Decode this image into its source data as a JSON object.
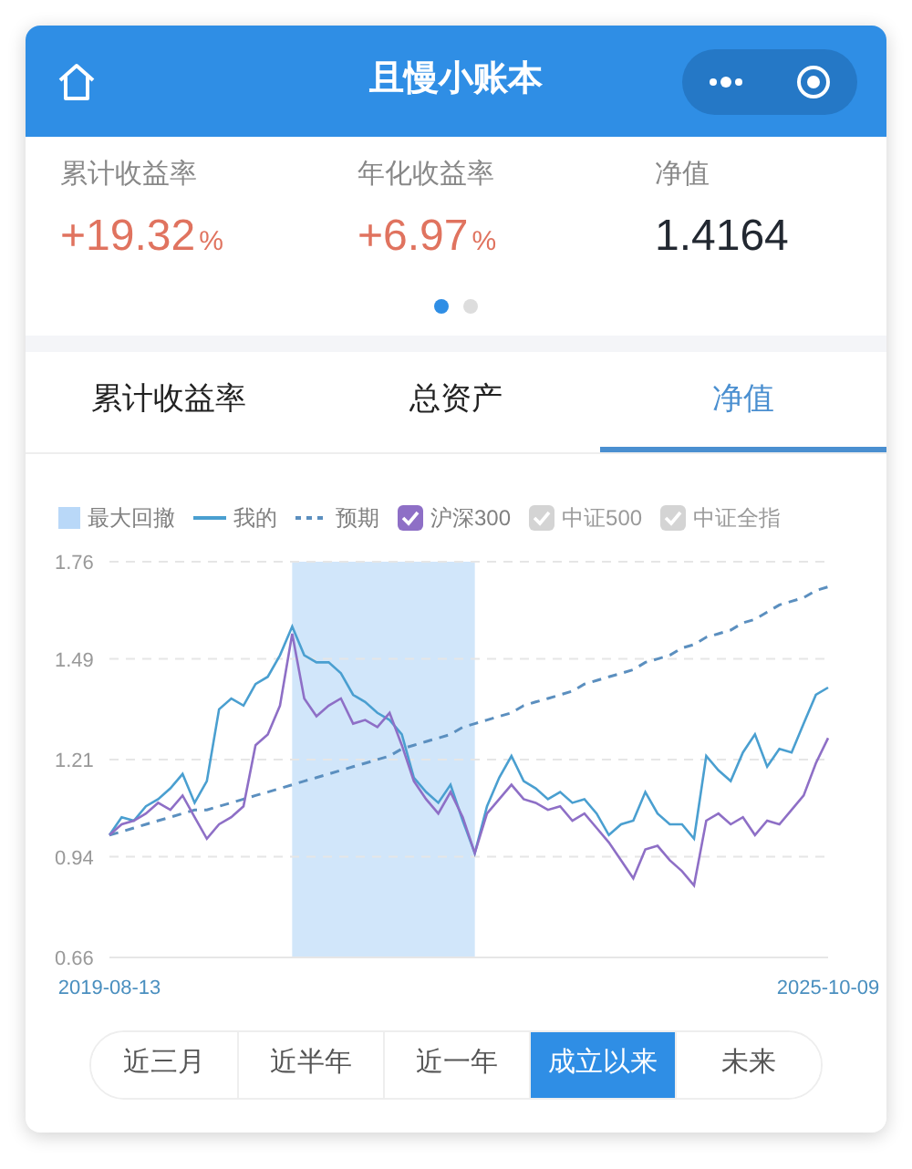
{
  "header": {
    "title": "且慢小账本"
  },
  "stats": [
    {
      "label": "累计收益率",
      "value": "+19.32",
      "unit": "%",
      "color": "#e0735f"
    },
    {
      "label": "年化收益率",
      "value": "+6.97",
      "unit": "%",
      "color": "#e0735f"
    },
    {
      "label": "净值",
      "value": "1.4164",
      "color": "#222831"
    }
  ],
  "pager": [
    {
      "selected": true
    },
    {
      "selected": false
    }
  ],
  "tabs": [
    {
      "label": "累计收益率",
      "selected": false
    },
    {
      "label": "总资产",
      "selected": false
    },
    {
      "label": "净值",
      "selected": true
    }
  ],
  "legend": [
    {
      "kind": "swatch",
      "label": "最大回撤",
      "color": "#b9d8f8"
    },
    {
      "kind": "series"
    },
    {
      "kind": "series"
    },
    {
      "kind": "series",
      "checked": true
    },
    {
      "kind": "checkbox",
      "label": "中证500",
      "checked": false
    },
    {
      "kind": "checkbox",
      "label": "中证全指",
      "checked": false
    }
  ],
  "chart_data": {
    "type": "line",
    "grid": true,
    "ylim": [
      0.66,
      1.76
    ],
    "categories": [
      "2019-08-13",
      null,
      null,
      null,
      null,
      null,
      null,
      null,
      null,
      null,
      null,
      null,
      null,
      null,
      null,
      null,
      null,
      null,
      null,
      null,
      null,
      null,
      null,
      null,
      null,
      null,
      null,
      null,
      null,
      null,
      null,
      null,
      null,
      null,
      null,
      null,
      null,
      null,
      null,
      null,
      null,
      null,
      null,
      null,
      null,
      null,
      null,
      null,
      null,
      null,
      null,
      null,
      null,
      null,
      null,
      null,
      null,
      null,
      null,
      "2025-10-09"
    ],
    "yticks": [
      {
        "value": 1.76,
        "label": "1.76"
      },
      {
        "value": 1.49,
        "label": "1.49"
      },
      {
        "value": 1.21,
        "label": "1.21"
      },
      {
        "value": 0.94,
        "label": "0.94"
      },
      {
        "value": 0.66,
        "label": "0.66"
      }
    ],
    "series": [
      {
        "name": "我的",
        "color": "#4a9fd0",
        "values": [
          1.0,
          1.05,
          1.04,
          1.08,
          1.1,
          1.13,
          1.17,
          1.09,
          1.15,
          1.35,
          1.38,
          1.36,
          1.42,
          1.44,
          1.5,
          1.58,
          1.5,
          1.48,
          1.48,
          1.45,
          1.39,
          1.37,
          1.34,
          1.32,
          1.28,
          1.16,
          1.12,
          1.09,
          1.14,
          1.04,
          0.95,
          1.08,
          1.16,
          1.22,
          1.15,
          1.13,
          1.1,
          1.12,
          1.09,
          1.1,
          1.06,
          1.0,
          1.03,
          1.04,
          1.12,
          1.06,
          1.03,
          1.03,
          0.99,
          1.22,
          1.18,
          1.15,
          1.23,
          1.28,
          1.19,
          1.24,
          1.23,
          1.31,
          1.39,
          1.41
        ]
      },
      {
        "name": "预期",
        "color": "#5b8fbf",
        "line_style": "dashed",
        "values": [
          1.0,
          1.01,
          1.02,
          1.03,
          1.04,
          1.05,
          1.06,
          1.07,
          1.07,
          1.08,
          1.09,
          1.1,
          1.11,
          1.12,
          1.13,
          1.14,
          1.15,
          1.16,
          1.17,
          1.18,
          1.19,
          1.2,
          1.21,
          1.22,
          1.24,
          1.25,
          1.26,
          1.27,
          1.28,
          1.3,
          1.31,
          1.32,
          1.33,
          1.34,
          1.36,
          1.37,
          1.38,
          1.39,
          1.4,
          1.42,
          1.43,
          1.44,
          1.45,
          1.46,
          1.48,
          1.49,
          1.5,
          1.52,
          1.53,
          1.55,
          1.56,
          1.57,
          1.59,
          1.6,
          1.62,
          1.64,
          1.65,
          1.66,
          1.68,
          1.69
        ]
      },
      {
        "name": "沪深300",
        "color": "#8e6fc6",
        "values": [
          1.0,
          1.03,
          1.04,
          1.06,
          1.09,
          1.07,
          1.11,
          1.05,
          0.99,
          1.03,
          1.05,
          1.08,
          1.25,
          1.28,
          1.36,
          1.56,
          1.38,
          1.33,
          1.36,
          1.38,
          1.31,
          1.32,
          1.3,
          1.34,
          1.25,
          1.15,
          1.1,
          1.06,
          1.12,
          1.05,
          0.95,
          1.06,
          1.1,
          1.14,
          1.1,
          1.09,
          1.07,
          1.08,
          1.04,
          1.06,
          1.02,
          0.98,
          0.93,
          0.88,
          0.96,
          0.97,
          0.93,
          0.9,
          0.86,
          1.04,
          1.06,
          1.03,
          1.05,
          1.0,
          1.04,
          1.03,
          1.07,
          1.11,
          1.2,
          1.27
        ]
      }
    ]
  },
  "ranges": [
    {
      "label": "近三月",
      "selected": false
    },
    {
      "label": "近半年",
      "selected": false
    },
    {
      "label": "近一年",
      "selected": false
    },
    {
      "label": "成立以来",
      "selected": true
    },
    {
      "label": "未来",
      "selected": false
    }
  ]
}
